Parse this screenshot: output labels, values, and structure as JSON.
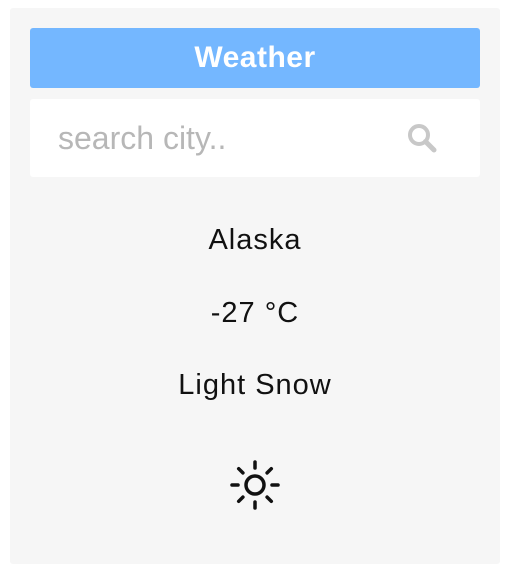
{
  "header": {
    "title": "Weather",
    "color": "#74b7ff"
  },
  "search": {
    "placeholder": "search city..",
    "value": "",
    "icon": "search-icon"
  },
  "weather": {
    "city": "Alaska",
    "temperature": "-27 °C",
    "description": "Light Snow",
    "icon": "sun-icon"
  },
  "colors": {
    "card_background": "#f6f6f6",
    "accent": "#74b7ff"
  }
}
